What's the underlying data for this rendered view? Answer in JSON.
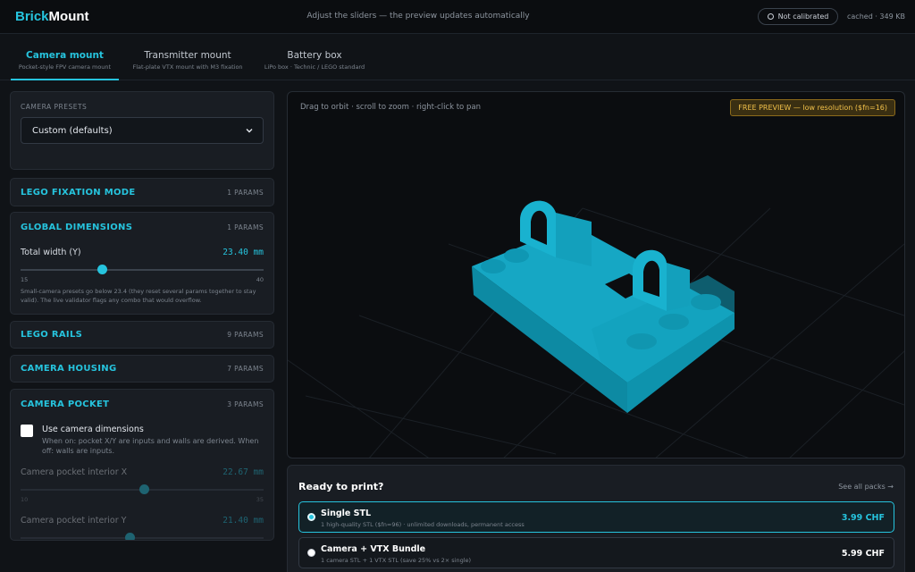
{
  "header": {
    "brand_part1": "Brick",
    "brand_part2": "Mount",
    "hint": "Adjust the sliders — the preview updates automatically",
    "calibration": "Not calibrated",
    "cache": "cached · 349 KB"
  },
  "tabs": [
    {
      "label": "Camera mount",
      "sub": "Pocket-style FPV camera mount",
      "active": true
    },
    {
      "label": "Transmitter mount",
      "sub": "Flat-plate VTX mount with M3 fixation",
      "active": false
    },
    {
      "label": "Battery box",
      "sub": "LiPo box · Technic / LEGO standard",
      "active": false
    }
  ],
  "presets": {
    "label": "CAMERA PRESETS",
    "selected": "Custom (defaults)"
  },
  "sections": {
    "lego_fixation": {
      "title": "LEGO FIXATION MODE",
      "params": "1 PARAMS"
    },
    "global_dimensions": {
      "title": "GLOBAL DIMENSIONS",
      "params": "1 PARAMS",
      "total_width": {
        "label": "Total width (Y)",
        "value": "23.40 mm",
        "min": "15",
        "max": "40",
        "fraction": 0.336
      },
      "note": "Small-camera presets go below 23.4 (they reset several params together to stay valid). The live validator flags any combo that would overflow."
    },
    "lego_rails": {
      "title": "LEGO RAILS",
      "params": "9 PARAMS"
    },
    "camera_housing": {
      "title": "CAMERA HOUSING",
      "params": "7 PARAMS"
    },
    "camera_pocket": {
      "title": "CAMERA POCKET",
      "params": "3 PARAMS",
      "use_dims_label": "Use camera dimensions",
      "use_dims_note": "When on: pocket X/Y are inputs and walls are derived. When off: walls are inputs.",
      "use_dims_checked": false,
      "pocket_x": {
        "label": "Camera pocket interior X",
        "value": "22.67 mm",
        "min": "10",
        "max": "35",
        "fraction": 0.51
      },
      "pocket_y": {
        "label": "Camera pocket interior Y",
        "value": "21.40 mm",
        "fraction": 0.45
      }
    }
  },
  "viewer": {
    "orbit_hint": "Drag to orbit · scroll to zoom · right-click to pan",
    "badge": "FREE PREVIEW — low resolution ($fn=16)"
  },
  "purchase": {
    "title": "Ready to print?",
    "see_all": "See all packs →",
    "options": [
      {
        "name": "Single STL",
        "desc": "1 high-quality STL ($fn=96) · unlimited downloads, permanent access",
        "price": "3.99 CHF",
        "selected": true
      },
      {
        "name": "Camera + VTX Bundle",
        "desc": "1 camera STL + 1 VTX STL (save 25% vs 2× single)",
        "price": "5.99 CHF",
        "selected": false
      }
    ]
  },
  "colors": {
    "accent": "#26c4de",
    "model": "#16a7c4",
    "badge": "#f2c14a",
    "background": "#101317"
  }
}
